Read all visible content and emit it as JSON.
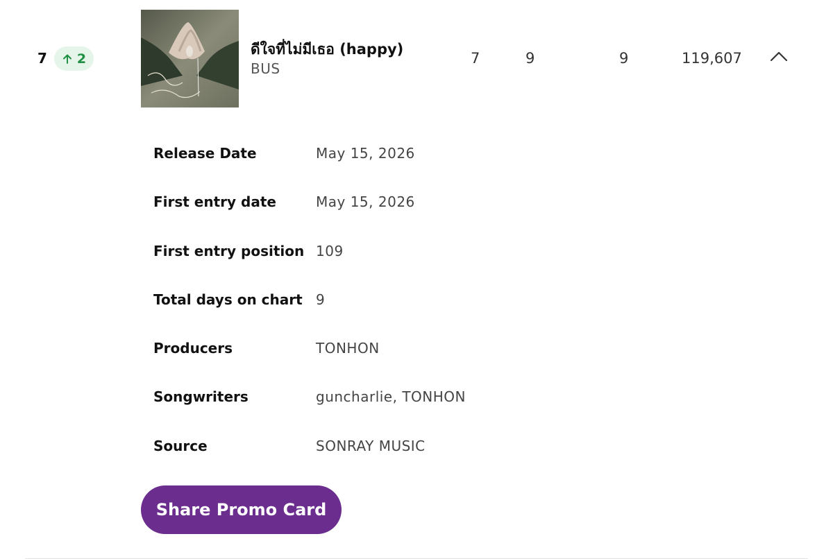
{
  "entry": {
    "rank": "7",
    "movement": {
      "direction": "up",
      "value": "2",
      "color": "#1f8f43"
    },
    "cover_icon": "album-cover-image",
    "title": "ดีใจที่ไม่มีเธอ (happy)",
    "artist": "BUS",
    "peak": "7",
    "previous": "9",
    "days": "9",
    "streams": "119,607",
    "collapse_icon": "chevron-up-icon"
  },
  "details": [
    {
      "label": "Release Date",
      "value": "May 15, 2026"
    },
    {
      "label": "First entry date",
      "value": "May 15, 2026"
    },
    {
      "label": "First entry position",
      "value": "109"
    },
    {
      "label": "Total days on chart",
      "value": "9"
    },
    {
      "label": "Producers",
      "value": "TONHON"
    },
    {
      "label": "Songwriters",
      "value": "guncharlie, TONHON"
    },
    {
      "label": "Source",
      "value": "SONRAY MUSIC"
    }
  ],
  "share_button": {
    "label": "Share Promo Card",
    "color": "#6b2d8e"
  }
}
